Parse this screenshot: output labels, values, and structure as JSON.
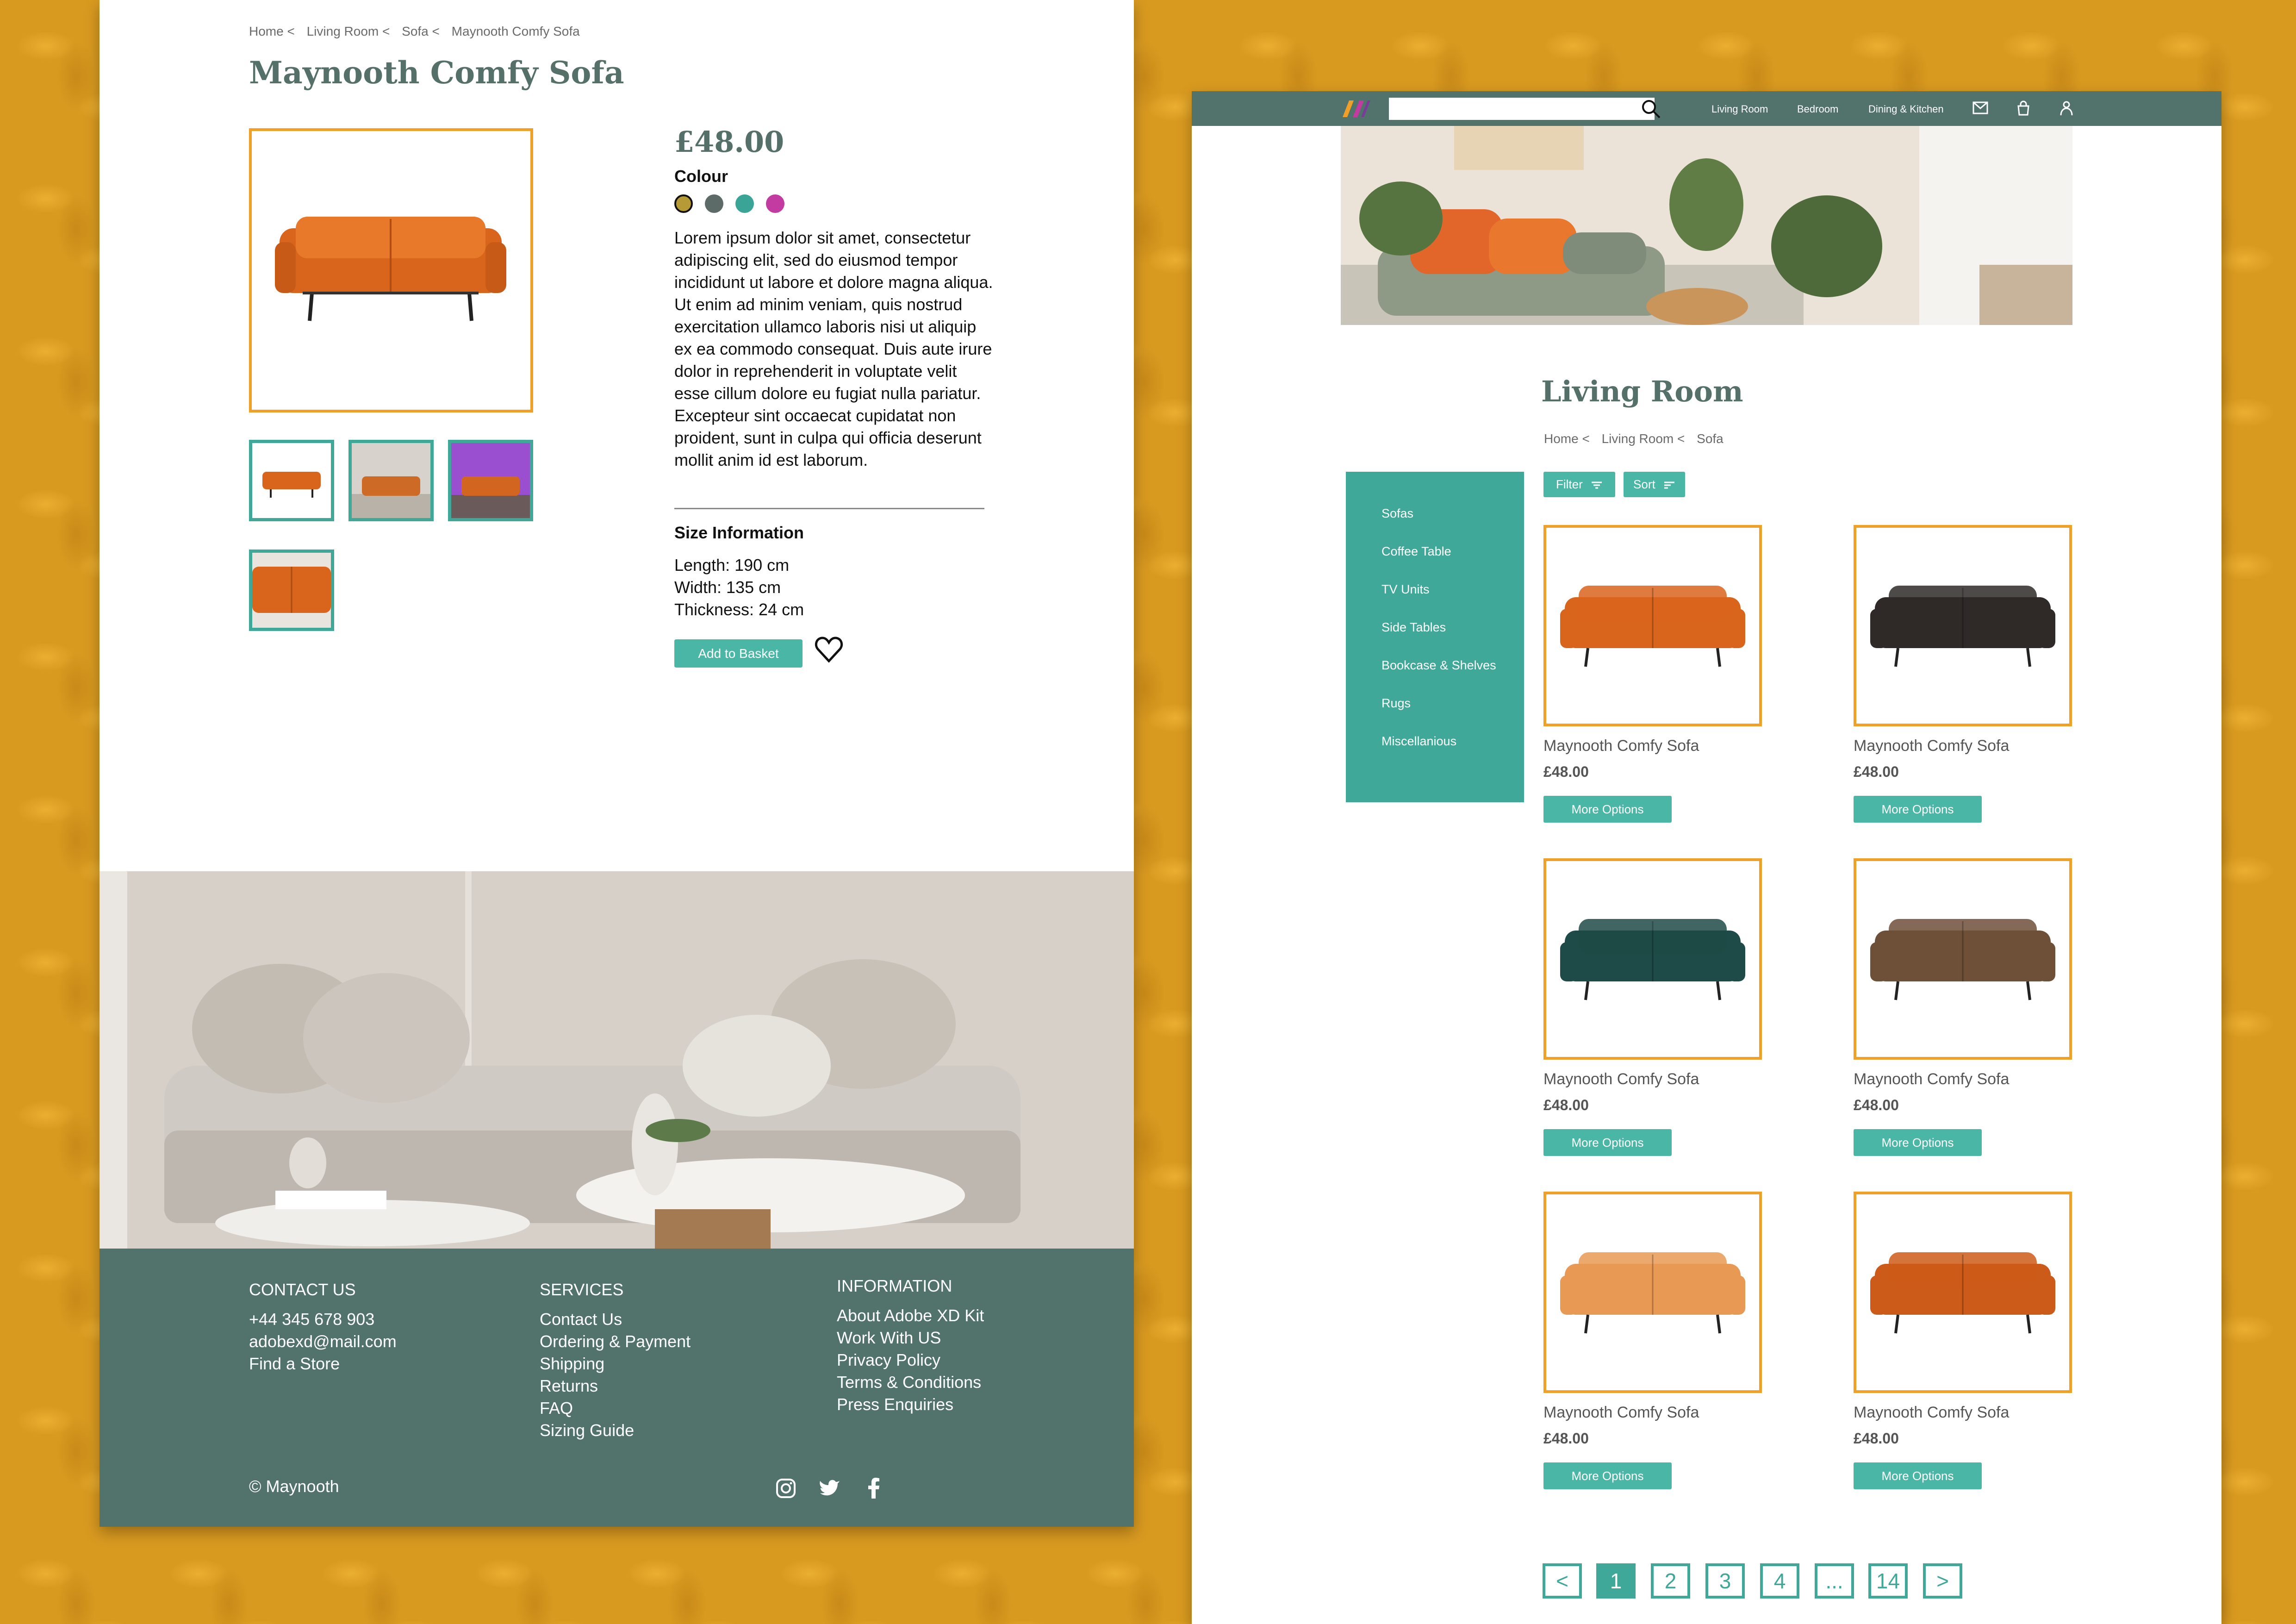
{
  "product_page": {
    "breadcrumb": [
      "Home <",
      "Living Room <",
      "Sofa <",
      "Maynooth Comfy Sofa"
    ],
    "title": "Maynooth Comfy Sofa",
    "price": "£48.00",
    "colour_label": "Colour",
    "colours": [
      "#b59a35",
      "#5c6b68",
      "#3aa596",
      "#c33aa0"
    ],
    "description": "Lorem ipsum dolor sit amet, consectetur adipiscing elit, sed do eiusmod tempor incididunt ut labore et dolore magna aliqua. Ut enim ad minim veniam, quis nostrud exercitation ullamco laboris nisi ut aliquip ex ea commodo consequat. Duis aute irure dolor in reprehenderit in voluptate velit esse cillum dolore eu fugiat nulla pariatur. Excepteur sint occaecat cupidatat non proident, sunt in culpa qui officia deserunt mollit anim id est laborum.",
    "size_heading": "Size Information",
    "size_lines": [
      "Length: 190 cm",
      "Width: 135 cm",
      "Thickness: 24 cm"
    ],
    "add_to_basket": "Add to Basket"
  },
  "footer": {
    "contact": {
      "heading": "CONTACT US",
      "lines": [
        "+44 345 678 903",
        "adobexd@mail.com",
        "Find a Store"
      ]
    },
    "services": {
      "heading": "SERVICES",
      "lines": [
        "Contact Us",
        "Ordering & Payment",
        "Shipping",
        "Returns",
        "FAQ",
        "Sizing Guide"
      ]
    },
    "information": {
      "heading": "INFORMATION",
      "lines": [
        "About Adobe XD Kit",
        "Work With US",
        "Privacy Policy",
        "Terms & Conditions",
        "Press Enquiries"
      ]
    },
    "copyright": "© Maynooth",
    "social_icons": [
      "instagram-icon",
      "twitter-icon",
      "facebook-icon"
    ]
  },
  "listing_page": {
    "nav": [
      "Living Room",
      "Bedroom",
      "Dining & Kitchen"
    ],
    "nav_icons": [
      "mail-icon",
      "basket-icon",
      "account-icon"
    ],
    "search_placeholder": "",
    "title": "Living Room",
    "breadcrumb": [
      "Home <",
      "Living Room <",
      "Sofa"
    ],
    "filter_label": "Filter",
    "sort_label": "Sort",
    "categories": [
      "Sofas",
      "Coffee Table",
      "TV Units",
      "Side Tables",
      "Bookcase & Shelves",
      "Rugs",
      "Miscellanious"
    ],
    "products": [
      {
        "name": "Maynooth Comfy Sofa",
        "price": "£48.00",
        "button": "More Options",
        "colour": "#d9641c"
      },
      {
        "name": "Maynooth Comfy Sofa",
        "price": "£48.00",
        "button": "More Options",
        "colour": "#2f2a28"
      },
      {
        "name": "Maynooth Comfy Sofa",
        "price": "£48.00",
        "button": "More Options",
        "colour": "#1e4a47"
      },
      {
        "name": "Maynooth Comfy Sofa",
        "price": "£48.00",
        "button": "More Options",
        "colour": "#6e5038"
      },
      {
        "name": "Maynooth Comfy Sofa",
        "price": "£48.00",
        "button": "More Options",
        "colour": "#e89a55"
      },
      {
        "name": "Maynooth Comfy Sofa",
        "price": "£48.00",
        "button": "More Options",
        "colour": "#cc5a18"
      }
    ],
    "pagination": [
      "<",
      "1",
      "2",
      "3",
      "4",
      "...",
      "14",
      ">"
    ],
    "current_page": "1"
  }
}
